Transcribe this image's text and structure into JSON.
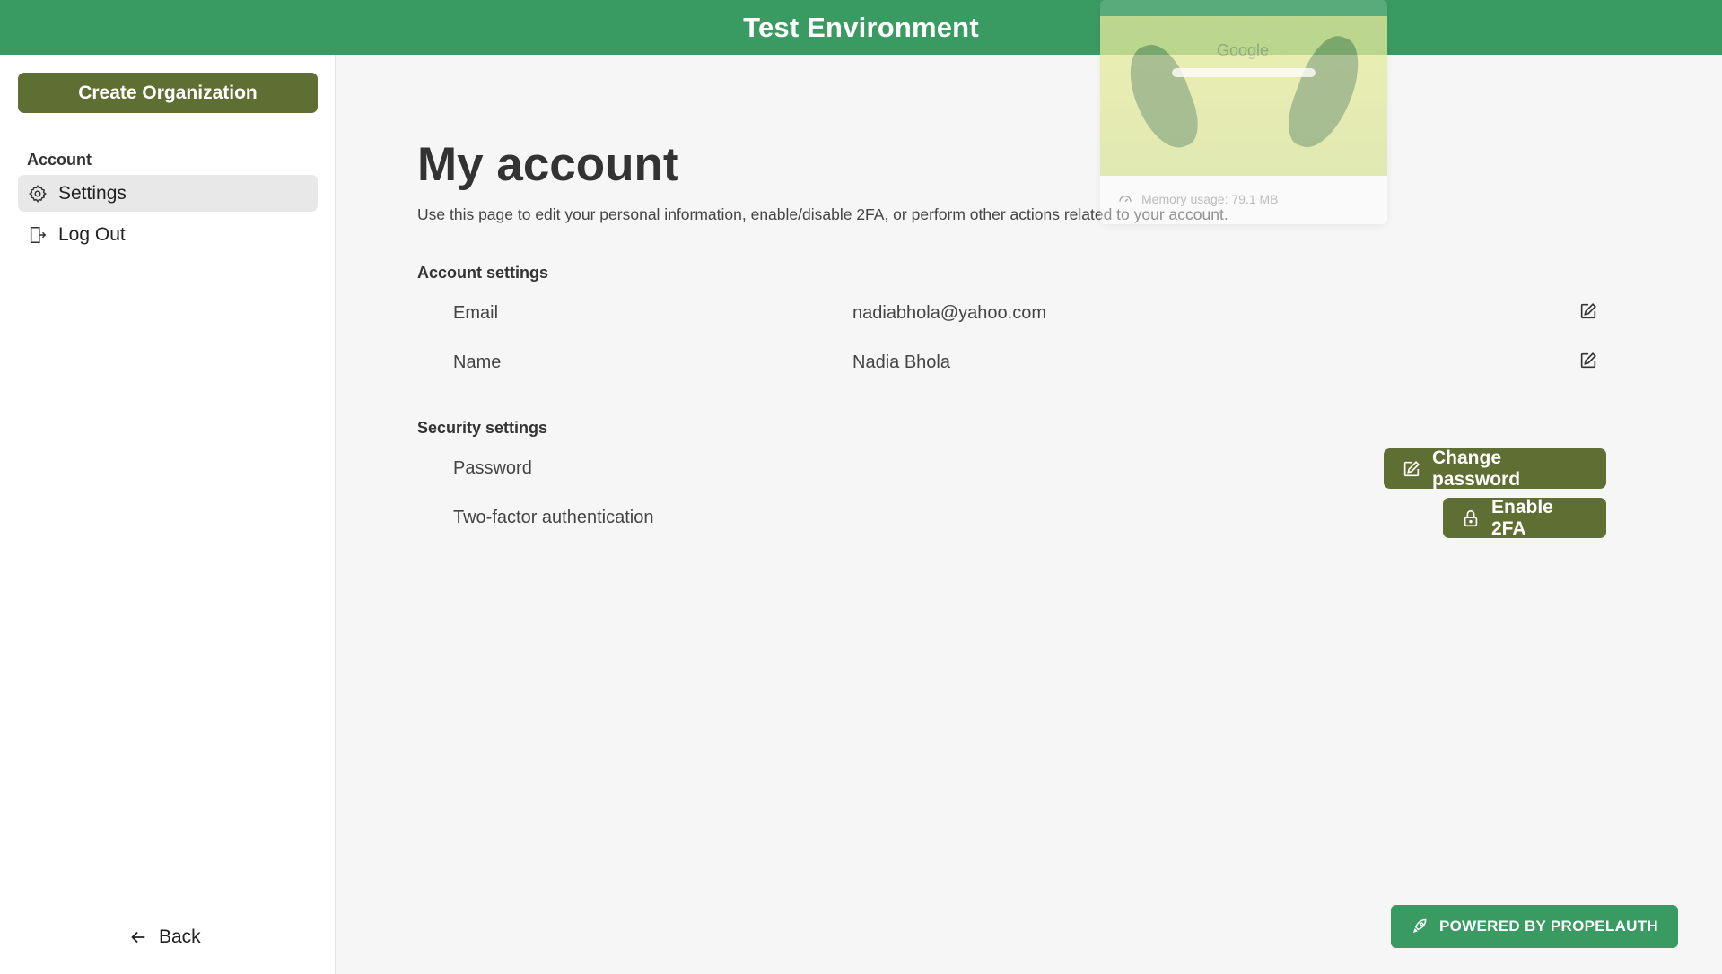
{
  "header": {
    "title": "Test Environment"
  },
  "sidebar": {
    "create_org_label": "Create Organization",
    "section_label": "Account",
    "items": [
      {
        "label": "Settings",
        "icon": "gear-icon",
        "active": true
      },
      {
        "label": "Log Out",
        "icon": "logout-icon",
        "active": false
      }
    ],
    "back_label": "Back"
  },
  "main": {
    "title": "My account",
    "description": "Use this page to edit your personal information, enable/disable 2FA, or perform other actions related to your account.",
    "account_settings": {
      "title": "Account settings",
      "rows": [
        {
          "label": "Email",
          "value": "nadiabhola@yahoo.com"
        },
        {
          "label": "Name",
          "value": "Nadia Bhola"
        }
      ]
    },
    "security_settings": {
      "title": "Security settings",
      "rows": [
        {
          "label": "Password",
          "button": "Change password"
        },
        {
          "label": "Two-factor authentication",
          "button": "Enable 2FA"
        }
      ]
    }
  },
  "footer": {
    "powered_label": "POWERED BY PROPELAUTH"
  },
  "overlay": {
    "thumb_text": "Google",
    "memory_text": "Memory usage: 79.1 MB"
  },
  "colors": {
    "header": "#3a9b62",
    "primary_button": "#5f6e32",
    "active_nav": "#e8e8e8"
  }
}
